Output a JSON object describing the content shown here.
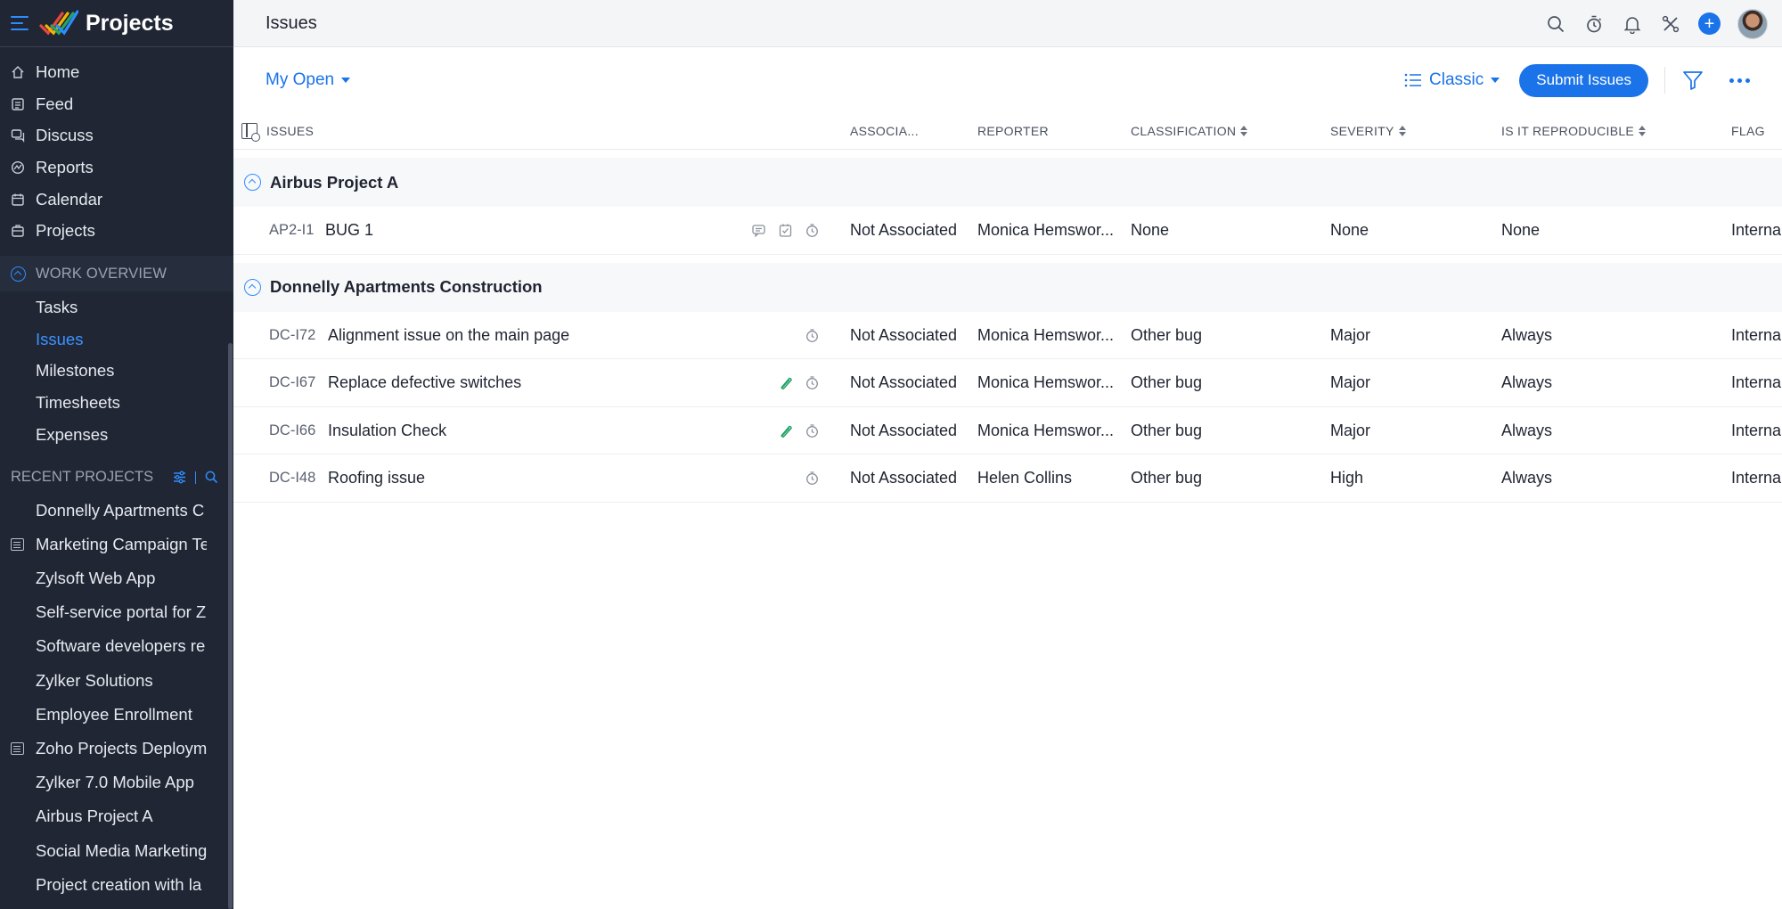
{
  "app": {
    "title": "Projects"
  },
  "nav": [
    {
      "label": "Home",
      "icon": "home-icon"
    },
    {
      "label": "Feed",
      "icon": "feed-icon"
    },
    {
      "label": "Discuss",
      "icon": "discuss-icon"
    },
    {
      "label": "Reports",
      "icon": "reports-icon"
    },
    {
      "label": "Calendar",
      "icon": "calendar-icon"
    },
    {
      "label": "Projects",
      "icon": "projects-icon"
    }
  ],
  "work_overview": {
    "heading": "WORK OVERVIEW",
    "items": [
      "Tasks",
      "Issues",
      "Milestones",
      "Timesheets",
      "Expenses"
    ],
    "active": "Issues"
  },
  "recent": {
    "heading": "RECENT PROJECTS",
    "items": [
      "Donnelly Apartments C",
      "Marketing Campaign Te",
      "Zylsoft Web App",
      "Self-service portal for Z",
      "Software developers re",
      "Zylker Solutions",
      "Employee Enrollment",
      "Zoho Projects Deploym",
      "Zylker 7.0 Mobile App",
      "Airbus Project A",
      "Social Media Marketing",
      "Project creation with la"
    ]
  },
  "topbar": {
    "title": "Issues"
  },
  "toolbar": {
    "view": "My Open",
    "layout": "Classic",
    "submit_label": "Submit Issues"
  },
  "table": {
    "headers": {
      "issues": "ISSUES",
      "associated": "ASSOCIA...",
      "reporter": "REPORTER",
      "classification": "CLASSIFICATION",
      "severity": "SEVERITY",
      "reproducible": "IS IT REPRODUCIBLE",
      "flag": "FLAG"
    },
    "groups": [
      {
        "name": "Airbus Project A",
        "rows": [
          {
            "key": "AP2-I1",
            "title": "BUG 1",
            "icons": [
              "comment-icon",
              "checklist-icon",
              "timer-icon"
            ],
            "associated": "Not Associated",
            "reporter": "Monica Hemswor...",
            "classification": "None",
            "severity": "None",
            "reproducible": "None",
            "flag": "Internal"
          }
        ]
      },
      {
        "name": "Donnelly Apartments Construction",
        "rows": [
          {
            "key": "DC-I72",
            "title": "Alignment issue on the main page",
            "icons": [
              "timer-icon"
            ],
            "associated": "Not Associated",
            "reporter": "Monica Hemswor...",
            "classification": "Other bug",
            "severity": "Major",
            "reproducible": "Always",
            "flag": "Internal"
          },
          {
            "key": "DC-I67",
            "title": "Replace defective switches",
            "icons": [
              "attachment-icon",
              "timer-icon"
            ],
            "associated": "Not Associated",
            "reporter": "Monica Hemswor...",
            "classification": "Other bug",
            "severity": "Major",
            "reproducible": "Always",
            "flag": "Internal"
          },
          {
            "key": "DC-I66",
            "title": "Insulation Check",
            "icons": [
              "attachment-icon",
              "timer-icon"
            ],
            "associated": "Not Associated",
            "reporter": "Monica Hemswor...",
            "classification": "Other bug",
            "severity": "Major",
            "reproducible": "Always",
            "flag": "Internal"
          },
          {
            "key": "DC-I48",
            "title": "Roofing issue",
            "icons": [
              "timer-icon"
            ],
            "associated": "Not Associated",
            "reporter": "Helen Collins",
            "classification": "Other bug",
            "severity": "High",
            "reproducible": "Always",
            "flag": "Internal"
          }
        ]
      }
    ]
  },
  "colors": {
    "accent": "#1a73e8",
    "sidebar_bg": "#202634",
    "attachment": "#21a366"
  }
}
